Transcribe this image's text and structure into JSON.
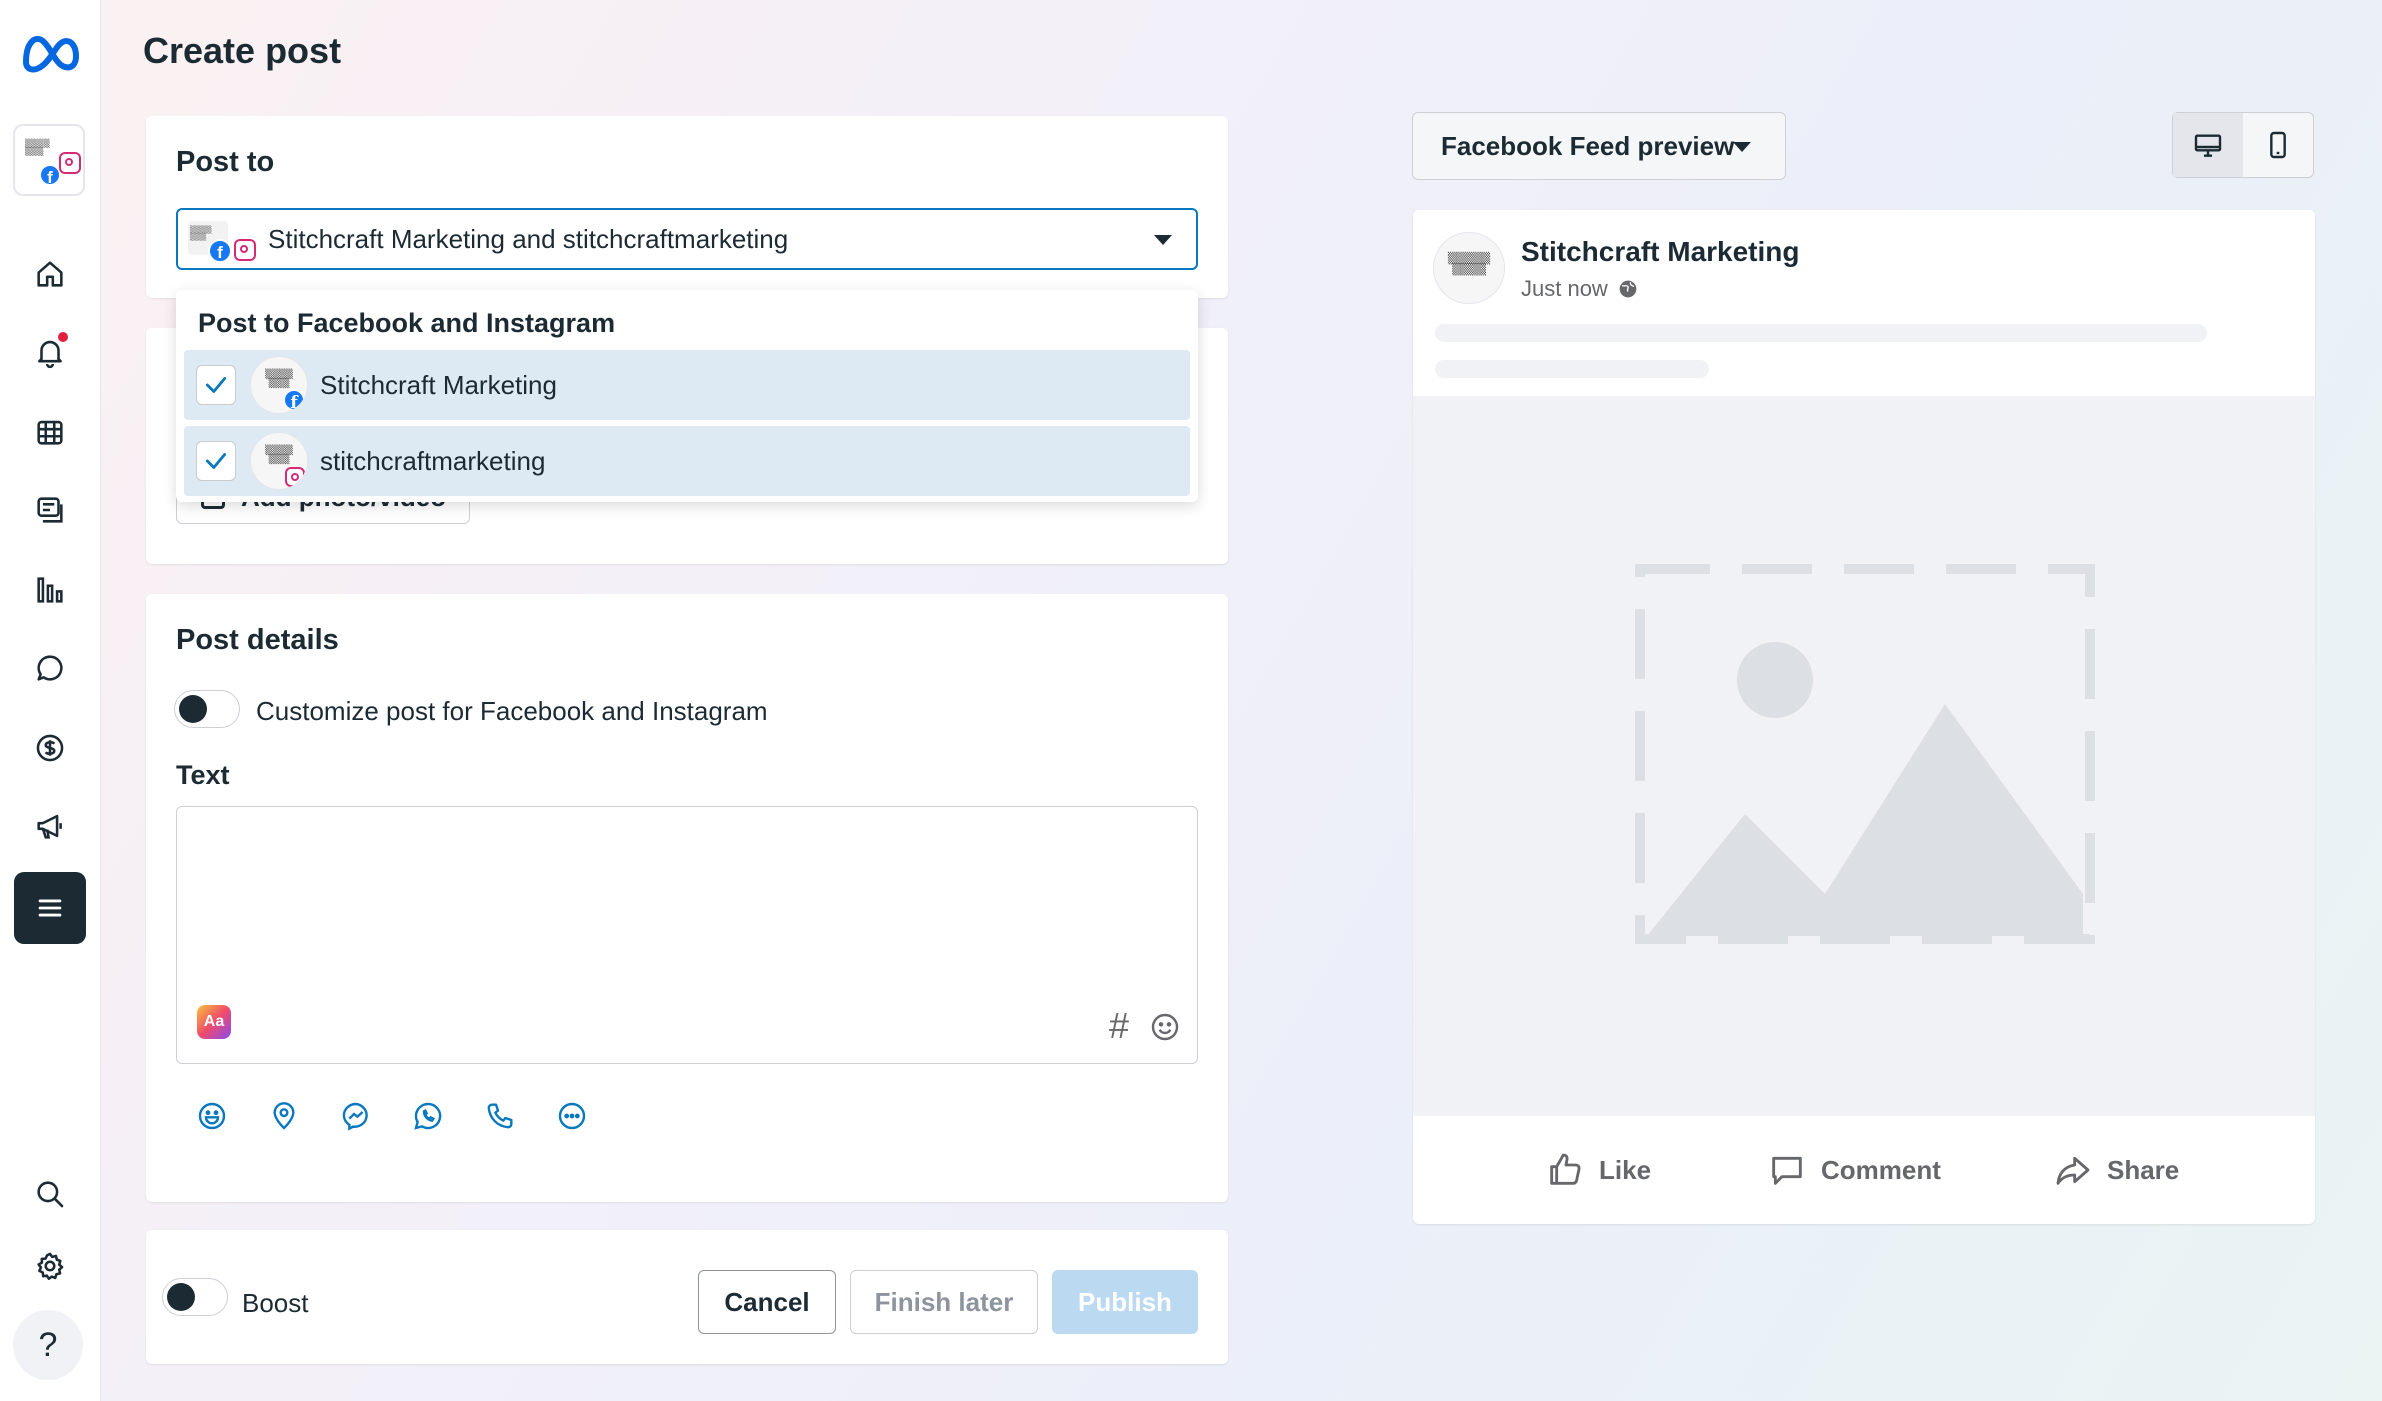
{
  "page": {
    "title": "Create post"
  },
  "sidebar": {
    "items": [
      {
        "name": "home",
        "icon": "home-icon"
      },
      {
        "name": "notifications",
        "icon": "bell-icon"
      },
      {
        "name": "calendar",
        "icon": "calendar-icon"
      },
      {
        "name": "content",
        "icon": "posts-icon"
      },
      {
        "name": "insights",
        "icon": "chart-icon"
      },
      {
        "name": "inbox",
        "icon": "chat-icon"
      },
      {
        "name": "monetization",
        "icon": "dollar-icon"
      },
      {
        "name": "ads",
        "icon": "megaphone-icon"
      },
      {
        "name": "all-tools",
        "icon": "menu-icon"
      }
    ],
    "bottom": [
      {
        "name": "search",
        "icon": "search-icon"
      },
      {
        "name": "settings",
        "icon": "gear-icon"
      },
      {
        "name": "help",
        "icon": "help-icon",
        "glyph": "?"
      }
    ]
  },
  "post_to": {
    "title": "Post to",
    "selected_value": "Stitchcraft Marketing and stitchcraftmarketing",
    "dropdown": {
      "header": "Post to Facebook and Instagram",
      "options": [
        {
          "label": "Stitchcraft Marketing",
          "checked": true,
          "platform": "facebook"
        },
        {
          "label": "stitchcraftmarketing",
          "checked": true,
          "platform": "instagram"
        }
      ]
    }
  },
  "media": {
    "add_button": "Add photo/video"
  },
  "post_details": {
    "title": "Post details",
    "customize_label": "Customize post for Facebook and Instagram",
    "customize_on": false,
    "text_label": "Text",
    "text_value": "",
    "hashtag_glyph": "#"
  },
  "footer": {
    "boost_label": "Boost",
    "boost_on": false,
    "cancel": "Cancel",
    "finish_later": "Finish later",
    "publish": "Publish"
  },
  "preview": {
    "selector": "Facebook Feed preview",
    "page_name": "Stitchcraft Marketing",
    "timestamp": "Just now",
    "actions": {
      "like": "Like",
      "comment": "Comment",
      "share": "Share"
    }
  },
  "colors": {
    "accent": "#0a78be",
    "dark": "#1c2b33",
    "row_selected": "#dde9f3",
    "publish_disabled": "#bcd9f2",
    "notification": "#e41e3f"
  }
}
